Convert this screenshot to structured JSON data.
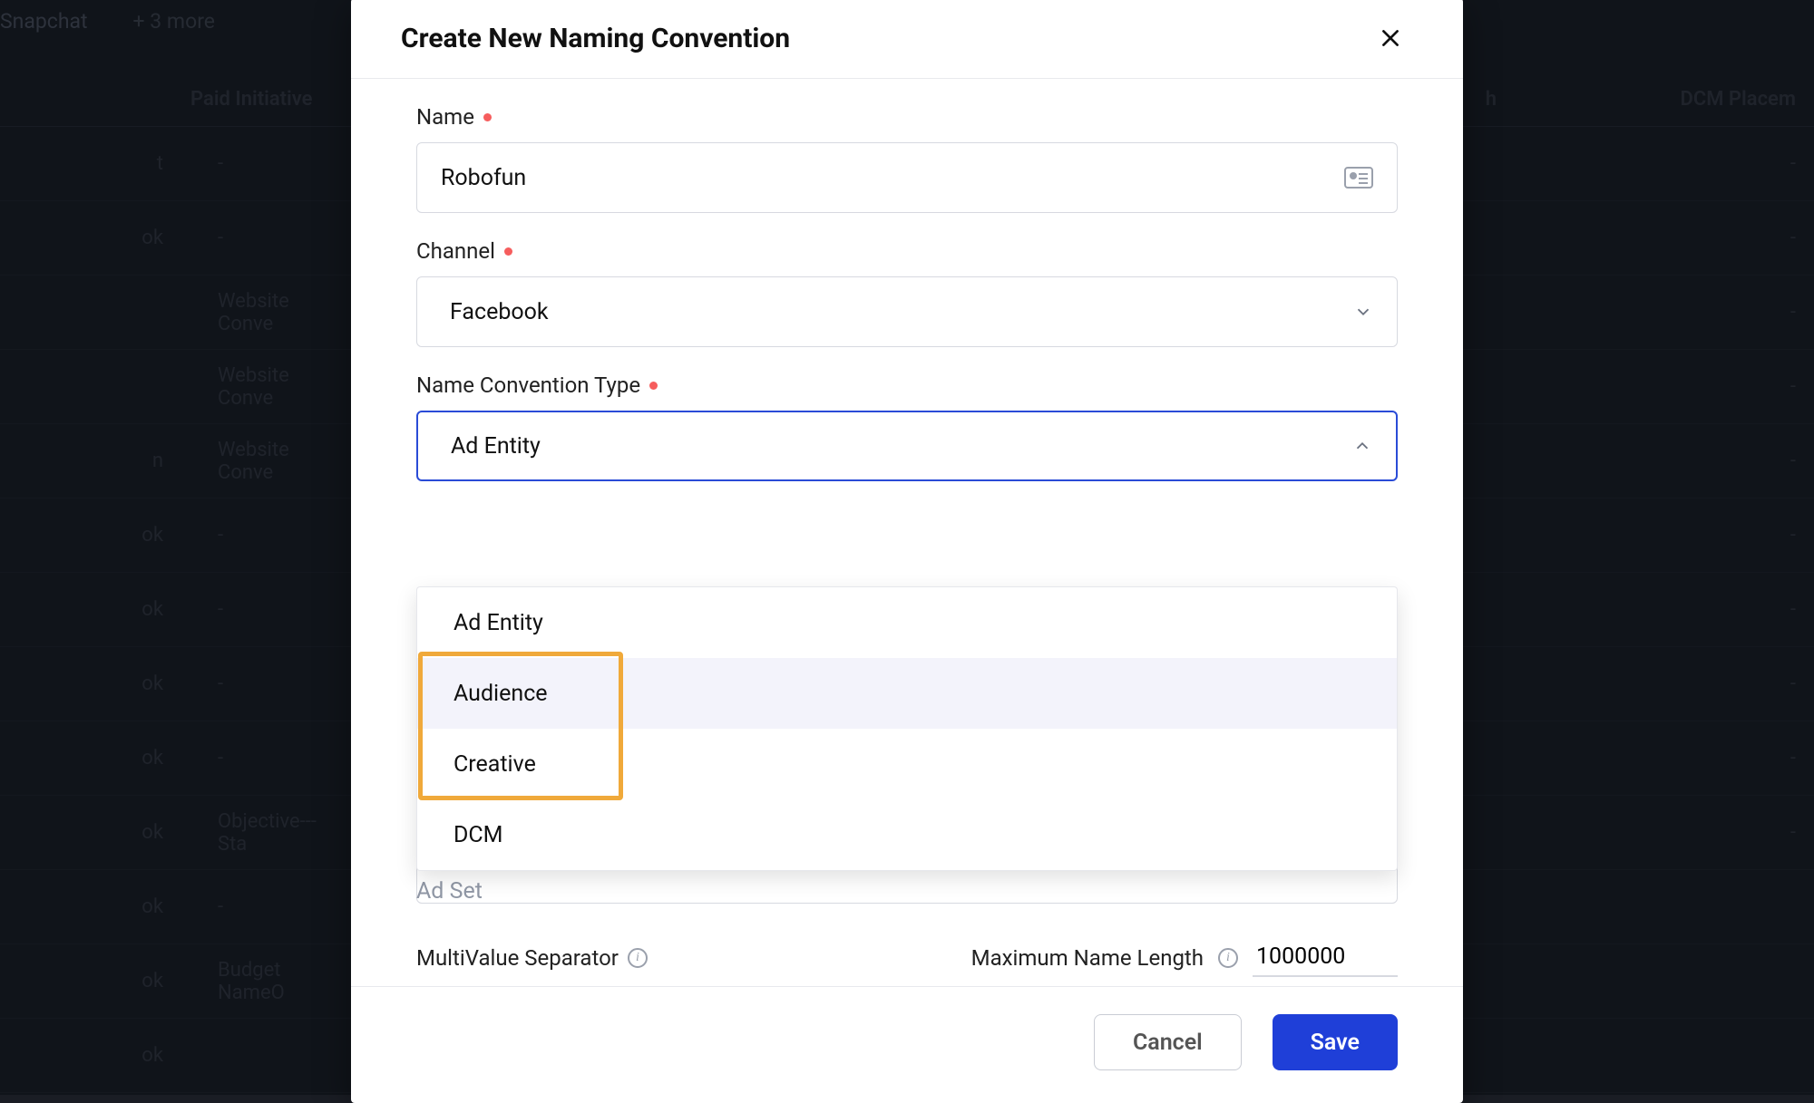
{
  "background": {
    "tabs": {
      "snapchat": "Snapchat",
      "more": "+ 3 more"
    },
    "headers": {
      "paid_initiative": "Paid Initiative",
      "dcm_placement": "DCM Placem"
    },
    "rows": [
      {
        "a": "t",
        "b": "-",
        "r": "-"
      },
      {
        "a": "ok",
        "b": "-",
        "r": "-"
      },
      {
        "a": "",
        "b": "Website Conve",
        "r": "-"
      },
      {
        "a": "",
        "b": "Website Conve",
        "r": "-"
      },
      {
        "a": "n",
        "b": "Website Conve",
        "r": "-"
      },
      {
        "a": "ok",
        "b": "-",
        "r": "-"
      },
      {
        "a": "ok",
        "b": "-",
        "r": "-"
      },
      {
        "a": "ok",
        "b": "-",
        "r": "-"
      },
      {
        "a": "ok",
        "b": "-",
        "r": "-"
      },
      {
        "a": "ok",
        "b": "Objective---Sta",
        "r": "-"
      },
      {
        "a": "ok",
        "b": "-",
        "r": ""
      },
      {
        "a": "ok",
        "b": "Budget NameO",
        "r": ""
      },
      {
        "a": "ok",
        "b": "",
        "r": ""
      }
    ],
    "h_col_gap": "h"
  },
  "modal": {
    "title": "Create New Naming Convention",
    "name_label": "Name",
    "name_value": "Robofun",
    "channel_label": "Channel",
    "channel_value": "Facebook",
    "type_label": "Name Convention Type",
    "type_value": "Ad Entity",
    "dropdown": {
      "options": [
        "Ad Entity",
        "Audience",
        "Creative",
        "DCM"
      ],
      "highlight_start": 1,
      "highlight_end": 2,
      "hovered_index": 1
    },
    "adset_behind": "Ad Set",
    "multivalue_label": "MultiValue Separator",
    "maxlen_label": "Maximum Name Length",
    "maxlen_value": "1000000",
    "cancel": "Cancel",
    "save": "Save"
  }
}
